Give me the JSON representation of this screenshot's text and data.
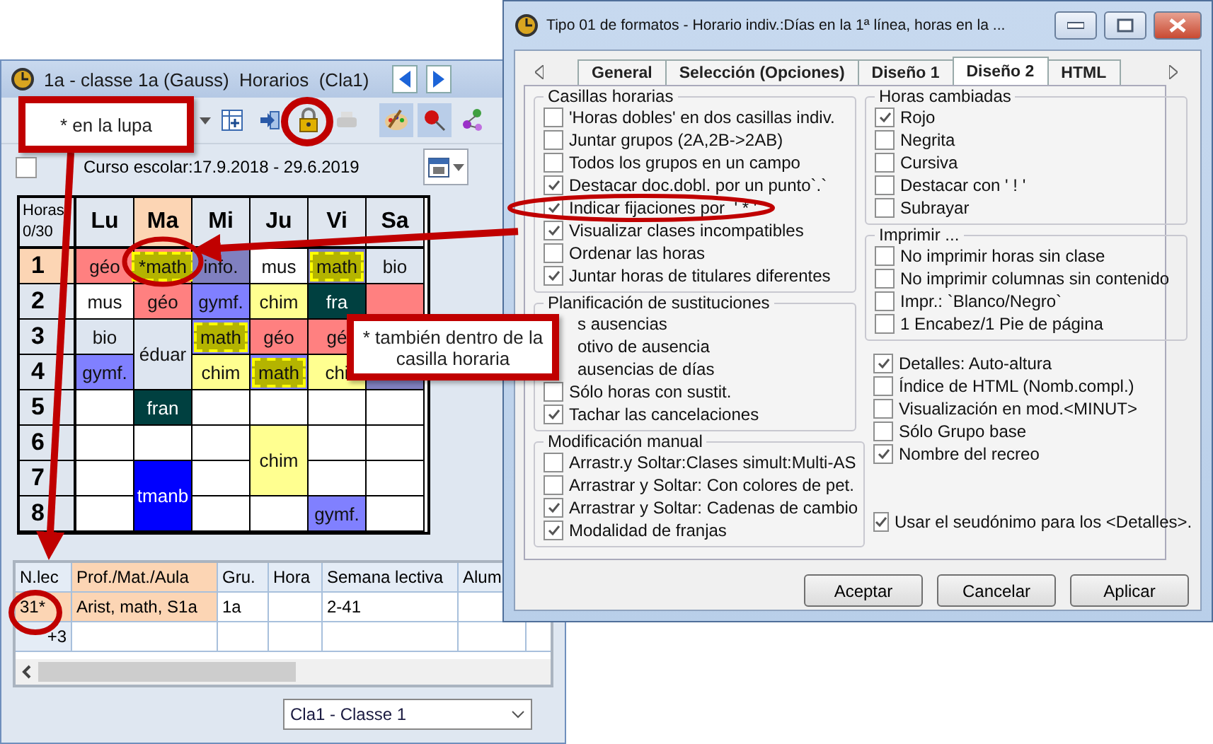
{
  "timetable_window": {
    "title": "1a - classe 1a (Gauss)  Horarios  (Cla1)",
    "view_toggle": {
      "checked": false
    },
    "school_year": "Curso escolar:17.9.2018 - 29.6.2019",
    "grid": {
      "corner_top": "Horas",
      "corner_bottom": "0/30",
      "days": [
        {
          "label": "Lu",
          "selected": false
        },
        {
          "label": "Ma",
          "selected": true
        },
        {
          "label": "Mi",
          "selected": false
        },
        {
          "label": "Ju",
          "selected": false
        },
        {
          "label": "Vi",
          "selected": false
        },
        {
          "label": "Sa",
          "selected": false
        }
      ],
      "hours": [
        {
          "label": "1",
          "selected": true
        },
        {
          "label": "2",
          "selected": false
        },
        {
          "label": "3",
          "selected": false
        },
        {
          "label": "4",
          "selected": false
        },
        {
          "label": "5",
          "selected": false
        },
        {
          "label": "6",
          "selected": false
        },
        {
          "label": "7",
          "selected": false
        },
        {
          "label": "8",
          "selected": false
        }
      ],
      "columns": [
        [
          {
            "kind": "normal",
            "subject": "géo",
            "color": "#ff8080"
          },
          {
            "kind": "normal",
            "subject": "mus",
            "color": "#ffffff"
          },
          {
            "kind": "normal",
            "subject": "bio",
            "color": "#dde5f0"
          },
          {
            "kind": "normal",
            "subject": "gymf.",
            "color": "#8080ff"
          },
          {
            "kind": "empty"
          },
          {
            "kind": "empty"
          },
          {
            "kind": "empty"
          },
          {
            "kind": "empty"
          }
        ],
        [
          {
            "kind": "fixed",
            "subject": "*math",
            "color": "#ff8080"
          },
          {
            "kind": "normal",
            "subject": "géo",
            "color": "#ff8080"
          },
          {
            "kind": "double",
            "subject": "éduar",
            "color": "#dde5f0"
          },
          {
            "kind": "normal",
            "subject": "fran",
            "color": "#004040"
          },
          {
            "kind": "empty"
          },
          {
            "kind": "double",
            "subject": "tmanb",
            "color": "#0000ff"
          }
        ],
        [
          {
            "kind": "normal",
            "subject": "info.",
            "color": "#8080c0"
          },
          {
            "kind": "normal",
            "subject": "gymf.",
            "color": "#8080ff"
          },
          {
            "kind": "fixed",
            "subject": "math",
            "color": "#8080ff"
          },
          {
            "kind": "normal",
            "subject": "chim",
            "color": "#ffff90"
          },
          {
            "kind": "empty"
          },
          {
            "kind": "empty"
          },
          {
            "kind": "empty"
          },
          {
            "kind": "empty"
          }
        ],
        [
          {
            "kind": "normal",
            "subject": "mus",
            "color": "#ffffff"
          },
          {
            "kind": "normal",
            "subject": "chim",
            "color": "#ffff90"
          },
          {
            "kind": "normal",
            "subject": "géo",
            "color": "#ff8080"
          },
          {
            "kind": "fixed",
            "subject": "math",
            "color": "#8080ff"
          },
          {
            "kind": "empty"
          },
          {
            "kind": "double",
            "subject": "chim",
            "color": "#ffff90"
          },
          {
            "kind": "empty"
          }
        ],
        [
          {
            "kind": "fixed",
            "subject": "math",
            "color": "#8080c0"
          },
          {
            "kind": "normal",
            "subject": "fra",
            "color": "#004040"
          },
          {
            "kind": "normal",
            "subject": "gé",
            "color": "#ff8080"
          },
          {
            "kind": "normal",
            "subject": "chi",
            "color": "#ffff90"
          },
          {
            "kind": "empty"
          },
          {
            "kind": "empty"
          },
          {
            "kind": "empty"
          },
          {
            "kind": "normal",
            "subject": "gymf.",
            "color": "#8080ff"
          }
        ],
        [
          {
            "kind": "normal",
            "subject": "bio",
            "color": "#dde5f0"
          },
          {
            "kind": "covered",
            "color": "#ff8080"
          },
          {
            "kind": "hidden"
          },
          {
            "kind": "covered",
            "color": "#8080c0"
          },
          {
            "kind": "empty"
          },
          {
            "kind": "empty"
          },
          {
            "kind": "empty"
          },
          {
            "kind": "empty"
          }
        ]
      ]
    },
    "lessons_table": {
      "columns": [
        "N.lec",
        "Prof./Mat./Aula",
        "Gru.",
        "Hora",
        "Semana lectiva",
        "Alum"
      ],
      "rows": [
        {
          "number": "31*",
          "teacher": "Arist, math, S1a",
          "group": "1a",
          "week": "2-41",
          "selected": true
        },
        {
          "number": "+3",
          "selected": false
        }
      ]
    },
    "class_select": {
      "value": "Cla1 - Classe 1"
    }
  },
  "format_dialog": {
    "title": "Tipo 01 de formatos - Horario indiv.:Días en la 1ª línea, horas en la ...",
    "tabs": [
      {
        "label": "General",
        "selected": false
      },
      {
        "label": "Selección (Opciones)",
        "selected": false
      },
      {
        "label": "Diseño 1",
        "selected": false
      },
      {
        "label": "Diseño 2",
        "selected": true
      },
      {
        "label": "HTML",
        "selected": false
      }
    ],
    "left_groups": [
      {
        "title": "Casillas horarias",
        "items": [
          {
            "kind": "checkbox",
            "label": "'Horas dobles' en dos casillas indiv.",
            "checked": false
          },
          {
            "kind": "checkbox",
            "label": "Juntar grupos (2A,2B->2AB)",
            "checked": false
          },
          {
            "kind": "checkbox",
            "label": "Todos los grupos en un campo",
            "checked": false
          },
          {
            "kind": "checkbox",
            "label": "Destacar doc.dobl. por un punto`.`",
            "checked": true
          },
          {
            "kind": "checkbox",
            "label": "Indicar fijaciones por  ' * '",
            "checked": true
          },
          {
            "kind": "checkbox",
            "label": "Visualizar clases incompatibles",
            "checked": true
          },
          {
            "kind": "checkbox",
            "label": "Ordenar las horas",
            "checked": false
          },
          {
            "kind": "checkbox",
            "label": "Juntar horas de titulares diferentes",
            "checked": true
          }
        ]
      },
      {
        "title": "Planificación de sustituciones",
        "items": [
          {
            "kind": "partial",
            "label": "s ausencias"
          },
          {
            "kind": "partial",
            "label": "otivo de ausencia"
          },
          {
            "kind": "partial",
            "label": "ausencias de días"
          },
          {
            "kind": "checkbox",
            "label": "Sólo horas con sustit.",
            "checked": false
          },
          {
            "kind": "checkbox",
            "label": "Tachar las cancelaciones",
            "checked": true
          }
        ]
      },
      {
        "title": "Modificación manual",
        "items": [
          {
            "kind": "checkbox",
            "label": "Arrastr.y Soltar:Clases simult:Multi-AS",
            "checked": false
          },
          {
            "kind": "checkbox",
            "label": "Arrastrar y Soltar: Con colores de pet.",
            "checked": false
          },
          {
            "kind": "checkbox",
            "label": "Arrastrar y Soltar: Cadenas de cambio",
            "checked": true
          },
          {
            "kind": "checkbox",
            "label": "Modalidad de franjas",
            "checked": true
          }
        ]
      }
    ],
    "right_groups": [
      {
        "title": "Horas cambiadas",
        "items": [
          {
            "kind": "checkbox",
            "label": "Rojo",
            "checked": true
          },
          {
            "kind": "checkbox",
            "label": "Negrita",
            "checked": false
          },
          {
            "kind": "checkbox",
            "label": "Cursiva",
            "checked": false
          },
          {
            "kind": "checkbox",
            "label": "Destacar con ' ! '",
            "checked": false
          },
          {
            "kind": "checkbox",
            "label": "Subrayar",
            "checked": false
          }
        ]
      },
      {
        "title": "Imprimir ...",
        "items": [
          {
            "kind": "checkbox",
            "label": "No imprimir horas sin clase",
            "checked": false
          },
          {
            "kind": "checkbox",
            "label": "No imprimir columnas sin contenido",
            "checked": false
          },
          {
            "kind": "checkbox",
            "label": "Impr.: `Blanco/Negro`",
            "checked": false
          },
          {
            "kind": "checkbox",
            "label": "1 Encabez/1 Pie de página",
            "checked": false
          }
        ]
      }
    ],
    "right_options": [
      {
        "kind": "checkbox",
        "label": "Detalles: Auto-altura",
        "checked": true
      },
      {
        "kind": "checkbox",
        "label": "Índice de HTML (Nomb.compl.)",
        "checked": false
      },
      {
        "kind": "checkbox",
        "label": "Visualización en mod.<MINUT>",
        "checked": false
      },
      {
        "kind": "checkbox",
        "label": "Sólo Grupo base",
        "checked": false
      },
      {
        "kind": "checkbox",
        "label": "Nombre del recreo",
        "checked": true
      }
    ],
    "bottom_option": {
      "kind": "checkbox",
      "label": "Usar el seudónimo para los <Detalles>.",
      "checked": true
    },
    "buttons": [
      "Aceptar",
      "Cancelar",
      "Aplicar"
    ]
  },
  "callouts": [
    {
      "text": "* en la lupa"
    },
    {
      "text": "* también dentro de la casilla horaria"
    }
  ]
}
